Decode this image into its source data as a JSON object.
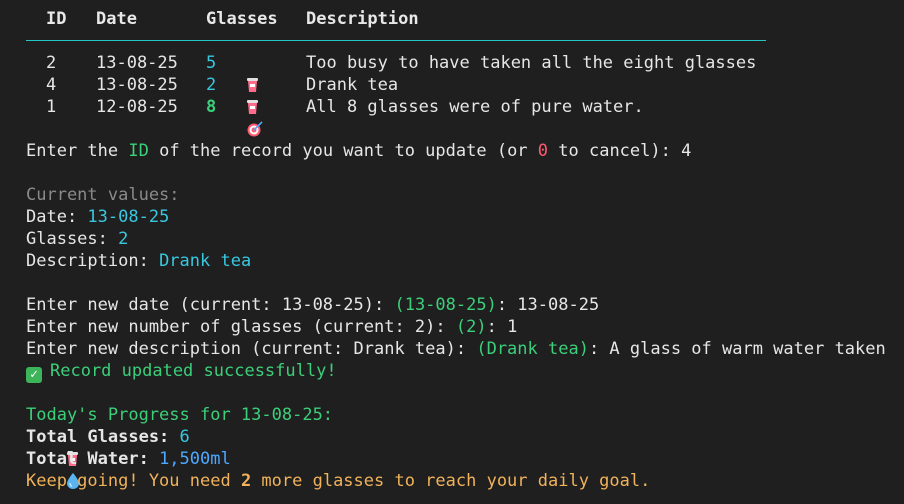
{
  "table": {
    "headers": [
      "ID",
      "Date",
      "Glasses",
      "Description"
    ],
    "rows": [
      {
        "id": "2",
        "date": "13-08-25",
        "glasses": "5",
        "description": "Too busy to have taken all the eight glasses",
        "icon": "cup-icon"
      },
      {
        "id": "4",
        "date": "13-08-25",
        "glasses": "2",
        "description": "Drank tea",
        "icon": "cup-icon"
      },
      {
        "id": "1",
        "date": "12-08-25",
        "glasses": "8",
        "description": "All 8 glasses were of pure water.",
        "icon": "target-icon"
      }
    ]
  },
  "prompt_id": {
    "text_a": "Enter the ",
    "id_word": "ID",
    "text_b": " of the record you want to update (or ",
    "zero": "0",
    "text_c": " to cancel): ",
    "input": "4"
  },
  "current": {
    "heading": "Current values:",
    "date_label": "Date: ",
    "date_value": "13-08-25",
    "glasses_label": "Glasses: ",
    "glasses_value": "2",
    "desc_label": "Description: ",
    "desc_value": "Drank tea"
  },
  "edits": {
    "date_prompt": "Enter new date (current: 13-08-25): ",
    "date_default": "(13-08-25)",
    "date_input": ": 13-08-25",
    "glasses_prompt": "Enter new number of glasses (current: 2): ",
    "glasses_default": "(2)",
    "glasses_input": ": 1",
    "desc_prompt": "Enter new description (current: Drank tea): ",
    "desc_default": "(Drank tea)",
    "desc_input": ": A glass of warm water taken"
  },
  "success": "Record updated successfully!",
  "progress": {
    "heading": "Today's Progress for 13-08-25:",
    "total_glasses_label": "Total Glasses: ",
    "total_glasses_value": "6",
    "total_water_label": "Total Water: ",
    "total_water_value": "1,500ml",
    "msg_a": "Keep going! You need ",
    "msg_num": "2",
    "msg_b": " more glasses to reach your daily goal."
  },
  "colors": {
    "background": "#1f1f1f",
    "accent_cyan": "#38c8e0",
    "accent_green": "#3ccf7a",
    "accent_red": "#ff5a6e",
    "accent_orange": "#f0b25a"
  }
}
